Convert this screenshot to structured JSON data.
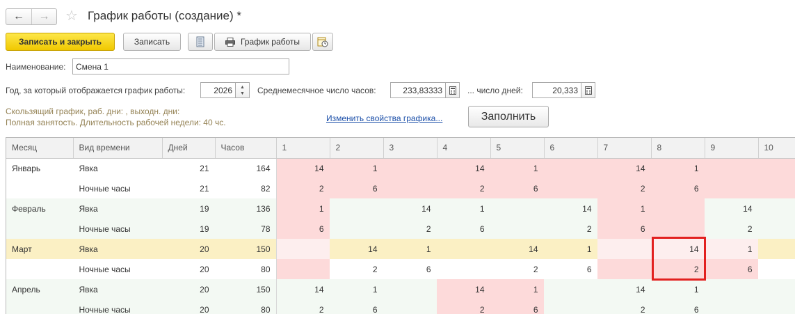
{
  "window": {
    "title": "График работы (создание) *",
    "back_icon": "←",
    "forward_icon": "→",
    "favorite_icon": "☆"
  },
  "toolbar": {
    "save_close_label": "Записать и закрыть",
    "save_label": "Записать",
    "schedule_print_label": "График работы"
  },
  "form": {
    "name_label": "Наименование:",
    "name_value": "Смена 1",
    "year_label": "Год, за который отображается график работы:",
    "year_value": "2026",
    "avg_hours_label": "Среднемесячное число часов:",
    "avg_hours_value": "233,83333",
    "avg_days_label": "... число дней:",
    "avg_days_value": "20,333"
  },
  "info": {
    "line1": "Скользящий график, раб. дни: , выходн. дни:",
    "line2": "Полная занятость. Длительность рабочей недели: 40 чс.",
    "change_link": "Изменить свойства графика...",
    "fill_button": "Заполнить"
  },
  "colors": {
    "primary": "#f5d20f",
    "work_day": "#fddada",
    "row_green": "#f3f9f3",
    "row_selected": "#fbf0c4",
    "highlight": "#e2201f"
  },
  "table": {
    "headers": [
      "Месяц",
      "Вид времени",
      "Дней",
      "Часов",
      "1",
      "2",
      "3",
      "4",
      "5",
      "6",
      "7",
      "8",
      "9",
      "10"
    ],
    "rows": [
      {
        "month": "Январь",
        "kind": "Явка",
        "days": "21",
        "hours": "164",
        "cells": [
          "14",
          "1",
          "",
          "14",
          "1",
          "",
          "14",
          "1",
          "",
          ""
        ],
        "bg": [
          "pink",
          "pink",
          "pink",
          "pink",
          "pink",
          "pink",
          "pink",
          "pink",
          "pink",
          "pink"
        ],
        "row_class": "row-white"
      },
      {
        "month": "",
        "kind": "Ночные часы",
        "days": "21",
        "hours": "82",
        "cells": [
          "2",
          "6",
          "",
          "2",
          "6",
          "",
          "2",
          "6",
          "",
          ""
        ],
        "bg": [
          "pink",
          "pink",
          "pink",
          "pink",
          "pink",
          "pink",
          "pink",
          "pink",
          "pink",
          "pink"
        ],
        "row_class": "row-white"
      },
      {
        "month": "Февраль",
        "kind": "Явка",
        "days": "19",
        "hours": "136",
        "cells": [
          "1",
          "",
          "14",
          "1",
          "",
          "14",
          "1",
          "",
          "14",
          ""
        ],
        "bg": [
          "pink",
          "",
          "",
          "",
          "",
          "",
          "pink",
          "pink",
          "",
          ""
        ],
        "row_class": "row-green"
      },
      {
        "month": "",
        "kind": "Ночные часы",
        "days": "19",
        "hours": "78",
        "cells": [
          "6",
          "",
          "2",
          "6",
          "",
          "2",
          "6",
          "",
          "2",
          ""
        ],
        "bg": [
          "pink",
          "",
          "",
          "",
          "",
          "",
          "pink",
          "pink",
          "",
          ""
        ],
        "row_class": "row-green"
      },
      {
        "month": "Март",
        "kind": "Явка",
        "days": "20",
        "hours": "150",
        "cells": [
          "",
          "14",
          "1",
          "",
          "14",
          "1",
          "",
          "14",
          "1",
          ""
        ],
        "bg": [
          "lightpink",
          "yellow",
          "yellow",
          "yellow",
          "yellow",
          "yellow",
          "lightpink",
          "lightpink",
          "lightpink",
          "yellow"
        ],
        "row_class": "row-yellow"
      },
      {
        "month": "",
        "kind": "Ночные часы",
        "days": "20",
        "hours": "80",
        "cells": [
          "",
          "2",
          "6",
          "",
          "2",
          "6",
          "",
          "2",
          "6",
          ""
        ],
        "bg": [
          "pink",
          "",
          "",
          "",
          "",
          "",
          "pink",
          "pink",
          "pink",
          ""
        ],
        "row_class": "row-white"
      },
      {
        "month": "Апрель",
        "kind": "Явка",
        "days": "20",
        "hours": "150",
        "cells": [
          "14",
          "1",
          "",
          "14",
          "1",
          "",
          "14",
          "1",
          "",
          ""
        ],
        "bg": [
          "",
          "",
          "",
          "pink",
          "pink",
          "",
          "",
          "",
          "",
          ""
        ],
        "row_class": "row-green"
      },
      {
        "month": "",
        "kind": "Ночные часы",
        "days": "20",
        "hours": "80",
        "cells": [
          "2",
          "6",
          "",
          "2",
          "6",
          "",
          "2",
          "6",
          "",
          ""
        ],
        "bg": [
          "",
          "",
          "",
          "pink",
          "pink",
          "",
          "",
          "",
          "",
          ""
        ],
        "row_class": "row-green"
      }
    ]
  }
}
